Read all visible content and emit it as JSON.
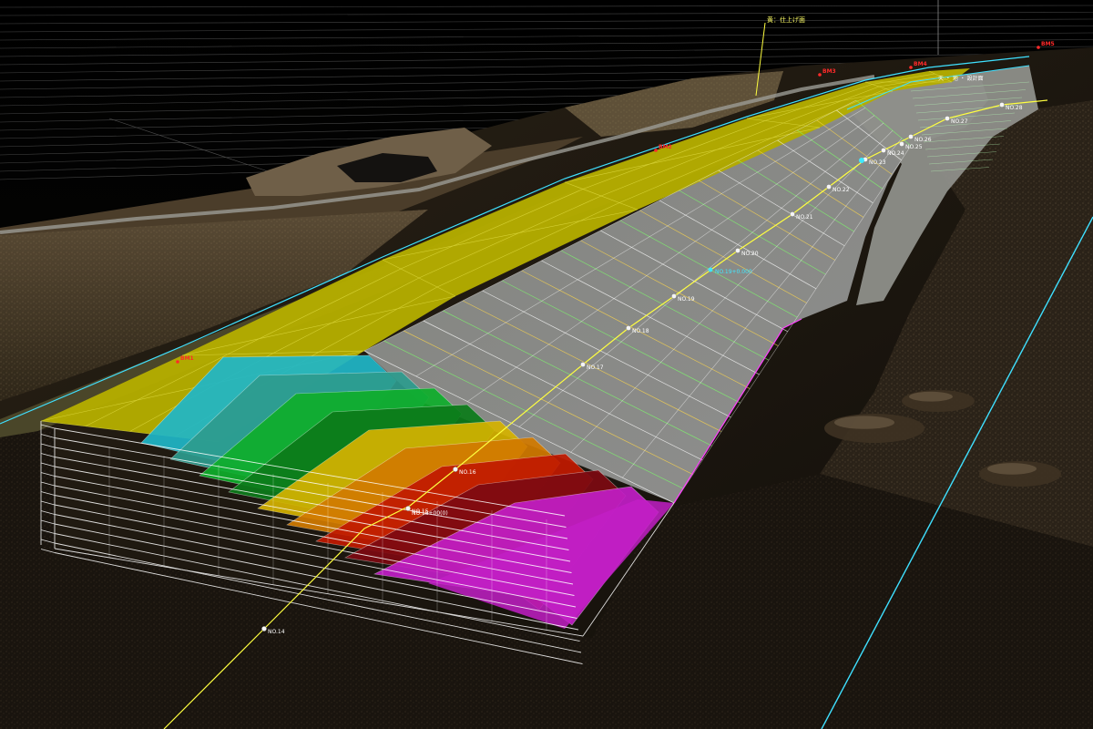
{
  "viewer": {
    "type": "3d-point-cloud-view",
    "colors": {
      "finish_surface": "#c8c000",
      "grid_lines": "#ffffff",
      "cyan_line": "#3fe0ff",
      "yellow_line": "#ffff40",
      "background": "#000000"
    }
  },
  "annotations": {
    "finish_surface_label": "黄：仕上げ面",
    "station_labels": [
      "NO.14",
      "NO.15",
      "NO.16",
      "NO.17",
      "NO.18",
      "NO.19",
      "NO.20",
      "NO.21",
      "NO.22",
      "NO.23",
      "NO.24",
      "NO.25",
      "NO.26",
      "NO.27",
      "NO.28"
    ],
    "station_label_sub": "NO.18+00(0)",
    "station_label_cyan": "NO.19+0.000",
    "red_markers": [
      "BM1",
      "BM2",
      "BM3",
      "BM4",
      "BM5"
    ],
    "top_right_text": "天 ・ 地 ・ 設計面"
  },
  "layers": {
    "tiers": [
      "cyan",
      "teal",
      "green",
      "dark-green",
      "yellow",
      "orange",
      "red",
      "dark-red",
      "magenta"
    ],
    "colors": [
      "#1fb7c8",
      "#2e9c8e",
      "#0fae2c",
      "#0c7b1a",
      "#d5b300",
      "#d27a00",
      "#c11a00",
      "#7d0a12",
      "#c21ec6"
    ]
  }
}
